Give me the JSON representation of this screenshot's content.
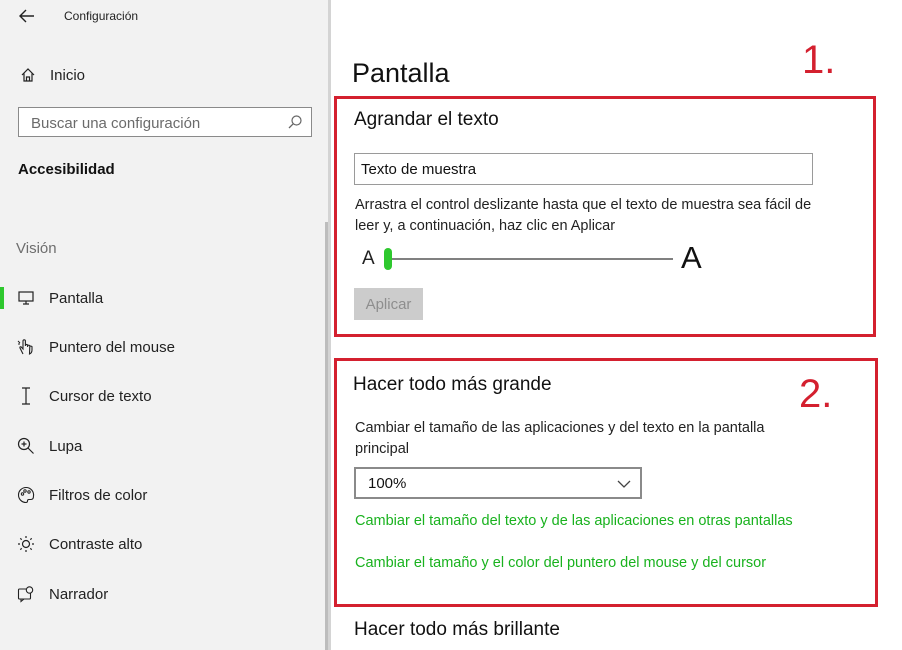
{
  "window": {
    "title": "Configuración"
  },
  "sidebar": {
    "home_label": "Inicio",
    "search_placeholder": "Buscar una configuración",
    "section_heading": "Accesibilidad",
    "group_label": "Visión",
    "items": [
      {
        "label": "Pantalla",
        "icon": "monitor-icon",
        "active": true
      },
      {
        "label": "Puntero del mouse",
        "icon": "pointer-hand-icon"
      },
      {
        "label": "Cursor de texto",
        "icon": "text-cursor-icon"
      },
      {
        "label": "Lupa",
        "icon": "magnifier-plus-icon"
      },
      {
        "label": "Filtros de color",
        "icon": "palette-icon"
      },
      {
        "label": "Contraste alto",
        "icon": "brightness-icon"
      },
      {
        "label": "Narrador",
        "icon": "narrator-icon"
      }
    ]
  },
  "main": {
    "page_title": "Pantalla",
    "text_size": {
      "title": "Agrandar el texto",
      "sample_text": "Texto de muestra",
      "description": "Arrastra el control deslizante hasta que el texto de muestra sea fácil de leer y, a continuación, haz clic en Aplicar",
      "slider_min_label": "A",
      "slider_max_label": "A",
      "slider_value": 0,
      "apply_label": "Aplicar"
    },
    "scale": {
      "title": "Hacer todo más grande",
      "description": "Cambiar el tamaño de las aplicaciones y del texto en la pantalla principal",
      "dropdown_value": "100%",
      "link_other_displays": "Cambiar el tamaño del texto y de las aplicaciones en otras pantallas",
      "link_pointer": "Cambiar el tamaño y el color del puntero del mouse y del cursor"
    },
    "brightness": {
      "title": "Hacer todo más brillante"
    }
  },
  "annotations": {
    "label_1": "1.",
    "label_2": "2."
  },
  "colors": {
    "accent_green": "#2ec82e",
    "link_green": "#19b21e",
    "annotation_red": "#d4202f"
  }
}
